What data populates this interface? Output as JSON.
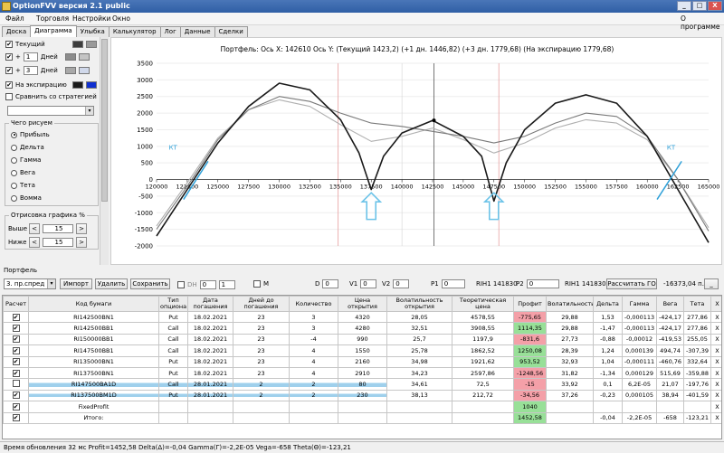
{
  "window": {
    "title": "OptionFVV версия 2.1 public",
    "minimize": "_",
    "maximize": "□",
    "close": "X"
  },
  "menu": {
    "file": "Файл",
    "trade": "Торговля",
    "settings": "Настройки",
    "window": "Окно",
    "about": "О программе"
  },
  "tabs": [
    "Доска",
    "Диаграмма",
    "Улыбка",
    "Калькулятор",
    "Лог",
    "Данные",
    "Сделки"
  ],
  "left": {
    "current": "Текущий",
    "plus": "+",
    "days": "Дней",
    "days1": "1",
    "days3": "3",
    "expiry": "На экспирацию",
    "compare": "Сравнить со стратегией",
    "what_draw": "Чего рисуем",
    "radios": [
      "Прибыль",
      "Дельта",
      "Гамма",
      "Вега",
      "Тета",
      "Вомма"
    ],
    "draw_pct": "Отрисовка графика %",
    "above": "Выше",
    "below": "Ниже",
    "above_val": "15",
    "below_val": "15",
    "dec": "<",
    "inc": ">",
    "colors": {
      "current": "#3d3d3d",
      "current2": "#9a9a9a",
      "d1": "#8c8c8c",
      "d1b": "#c4c4c4",
      "d3": "#a8a8a8",
      "d3b": "#d0d8ea",
      "exp": "#1a1a1a",
      "expb": "#1030d0"
    }
  },
  "chart": {
    "header": "Портфель: Ось X: 142610 Ось Y:  (Текущий 1423,2)  (+1 дн. 1446,82)  (+3 дн. 1779,68)  (На экспирацию 1779,68)",
    "kt_left": "КТ",
    "kt_right": "КТ"
  },
  "chart_data": {
    "type": "line",
    "xlim": [
      120000,
      165000
    ],
    "ylim": [
      -2000,
      3500
    ],
    "xticks": [
      "120000",
      "122500",
      "125000",
      "127500",
      "130000",
      "132500",
      "135000",
      "137500",
      "140000",
      "142500",
      "145000",
      "147500",
      "150000",
      "152500",
      "155000",
      "157500",
      "160000",
      "162500",
      "165000"
    ],
    "yticks": [
      "3500",
      "3000",
      "2500",
      "2000",
      "1500",
      "1000",
      "500",
      "0",
      "-500",
      "-1000",
      "-1500",
      "-2000"
    ],
    "series": [
      {
        "color": "#1a1a1a",
        "x": [
          120000,
          122500,
          125000,
          127500,
          130000,
          132500,
          135000,
          136500,
          137500,
          138500,
          140000,
          142500,
          145000,
          146500,
          147500,
          148500,
          150000,
          152500,
          155000,
          157500,
          160000,
          162500,
          165000
        ],
        "y": [
          -1700,
          -300,
          1100,
          2200,
          2900,
          2700,
          1800,
          800,
          -300,
          700,
          1400,
          1780,
          1300,
          700,
          -650,
          500,
          1500,
          2300,
          2550,
          2300,
          1300,
          -300,
          -1900
        ]
      },
      {
        "color": "#7a7a7a",
        "x": [
          120000,
          122500,
          125000,
          127500,
          130000,
          132500,
          135000,
          137500,
          140000,
          142500,
          145000,
          147500,
          150000,
          152500,
          155000,
          157500,
          160000,
          162500,
          165000
        ],
        "y": [
          -1500,
          -200,
          1200,
          2100,
          2500,
          2350,
          2000,
          1700,
          1600,
          1450,
          1300,
          1100,
          1300,
          1700,
          2000,
          1900,
          1300,
          0,
          -1550
        ]
      },
      {
        "color": "#b0b0b0",
        "x": [
          120000,
          122500,
          125000,
          127500,
          130000,
          132500,
          135000,
          137500,
          140000,
          142500,
          145000,
          147500,
          150000,
          152500,
          155000,
          157500,
          160000,
          162500,
          165000
        ],
        "y": [
          -1400,
          -100,
          1250,
          2100,
          2400,
          2200,
          1650,
          1150,
          1300,
          1550,
          1200,
          800,
          1100,
          1550,
          1800,
          1700,
          1200,
          0,
          -1450
        ]
      }
    ]
  },
  "portfolio_label": "Портфель",
  "toolbar": {
    "strategy": "3. пр.спред",
    "import": "Импорт",
    "delete": "Удалить",
    "save": "Сохранить",
    "dh": "DH",
    "dh_a": "0",
    "dh_b": "1",
    "m": "M",
    "d": "D",
    "d_val": "0",
    "v1": "V1",
    "v1_val": "0",
    "v2": "V2",
    "v2_val": "0",
    "p1": "P1",
    "p1_val": "0",
    "rih1": "RIH1 141830",
    "p2": "P2",
    "p2_val": "0",
    "rih2": "RIH1 141830",
    "calc_go": "Рассчитать ГО",
    "go_val": "-16373,04 п.",
    "dash": "_"
  },
  "table": {
    "headers": [
      "Расчет",
      "Код бумаги",
      "Тип опциона",
      "Дата погашения",
      "Дней до погашения",
      "Количество",
      "Цена открытия",
      "Волатильность открытия",
      "Теоретическая цена",
      "Профит",
      "Волатильность",
      "Дельта",
      "Гамма",
      "Вега",
      "Тета",
      "X"
    ],
    "rows": [
      {
        "check": "✔",
        "code": "RI142500BN1",
        "type": "Put",
        "date": "18.02.2021",
        "days": "23",
        "qty": "3",
        "price": "4320",
        "vol_open": "28,05",
        "theo": "4578,55",
        "profit": "-775,65",
        "pc": "red",
        "vol": "29,88",
        "delta": "1,53",
        "gamma": "-0,000113",
        "vega": "-424,17",
        "theta": "277,86",
        "x": "X"
      },
      {
        "check": "✔",
        "code": "RI142500BB1",
        "type": "Call",
        "date": "18.02.2021",
        "days": "23",
        "qty": "3",
        "price": "4280",
        "vol_open": "32,51",
        "theo": "3908,55",
        "profit": "1114,35",
        "pc": "green",
        "vol": "29,88",
        "delta": "-1,47",
        "gamma": "-0,000113",
        "vega": "-424,17",
        "theta": "277,86",
        "x": "X"
      },
      {
        "check": "✔",
        "code": "RI150000BB1",
        "type": "Call",
        "date": "18.02.2021",
        "days": "23",
        "qty": "-4",
        "price": "990",
        "vol_open": "25,7",
        "theo": "1197,9",
        "profit": "-831,6",
        "pc": "red",
        "vol": "27,73",
        "delta": "-0,88",
        "gamma": "-0,00012",
        "vega": "-419,53",
        "theta": "255,05",
        "x": "X"
      },
      {
        "check": "✔",
        "code": "RI147500BB1",
        "type": "Call",
        "date": "18.02.2021",
        "days": "23",
        "qty": "4",
        "price": "1550",
        "vol_open": "25,78",
        "theo": "1862,52",
        "profit": "1250,08",
        "pc": "green",
        "vol": "28,39",
        "delta": "1,24",
        "gamma": "0,000139",
        "vega": "494,74",
        "theta": "-307,39",
        "x": "X"
      },
      {
        "check": "✔",
        "code": "RI135000BN1",
        "type": "Put",
        "date": "18.02.2021",
        "days": "23",
        "qty": "4",
        "price": "2160",
        "vol_open": "34,98",
        "theo": "1921,62",
        "profit": "953,52",
        "pc": "green",
        "vol": "32,93",
        "delta": "1,04",
        "gamma": "-0,000111",
        "vega": "-460,76",
        "theta": "332,64",
        "x": "X"
      },
      {
        "check": "✔",
        "code": "RI137500BN1",
        "type": "Put",
        "date": "18.02.2021",
        "days": "23",
        "qty": "4",
        "price": "2910",
        "vol_open": "34,23",
        "theo": "2597,86",
        "profit": "-1248,56",
        "pc": "red",
        "vol": "31,82",
        "delta": "-1,34",
        "gamma": "0,000129",
        "vega": "515,69",
        "theta": "-359,88",
        "x": "X"
      },
      {
        "check": "",
        "code": "RI147500BA1D",
        "type": "Call",
        "date": "28.01.2021",
        "days": "2",
        "qty": "2",
        "price": "80",
        "vol_open": "34,61",
        "theo": "72,5",
        "profit": "-15",
        "pc": "red",
        "vol": "33,92",
        "delta": "0,1",
        "gamma": "6,2E-05",
        "vega": "21,07",
        "theta": "-197,76",
        "x": "X",
        "hl": true
      },
      {
        "check": "✔",
        "code": "RI137500BM1D",
        "type": "Put",
        "date": "28.01.2021",
        "days": "2",
        "qty": "2",
        "price": "230",
        "vol_open": "38,13",
        "theo": "212,72",
        "profit": "-34,56",
        "pc": "red",
        "vol": "37,26",
        "delta": "-0,23",
        "gamma": "0,000105",
        "vega": "38,94",
        "theta": "-401,59",
        "x": "X",
        "hl": true
      },
      {
        "check": "✔",
        "code": "FixedProfit",
        "type": "",
        "date": "",
        "days": "",
        "qty": "",
        "price": "",
        "vol_open": "",
        "theo": "",
        "profit": "1040",
        "pc": "green",
        "vol": "",
        "delta": "",
        "gamma": "",
        "vega": "",
        "theta": "",
        "x": "X"
      },
      {
        "check": "✔",
        "code": "Итого:",
        "type": "",
        "date": "",
        "days": "",
        "qty": "",
        "price": "",
        "vol_open": "",
        "theo": "",
        "profit": "1452,58",
        "pc": "green",
        "vol": "",
        "delta": "-0,04",
        "gamma": "-2,2E-05",
        "vega": "-658",
        "theta": "-123,21",
        "x": "X"
      }
    ]
  },
  "status": "Время обновления 32 мс  Profit=1452,58 Delta(Δ)=-0,04 Gamma(Γ)=-2,2E-05 Vega=-658 Theta(Θ)=-123,21"
}
